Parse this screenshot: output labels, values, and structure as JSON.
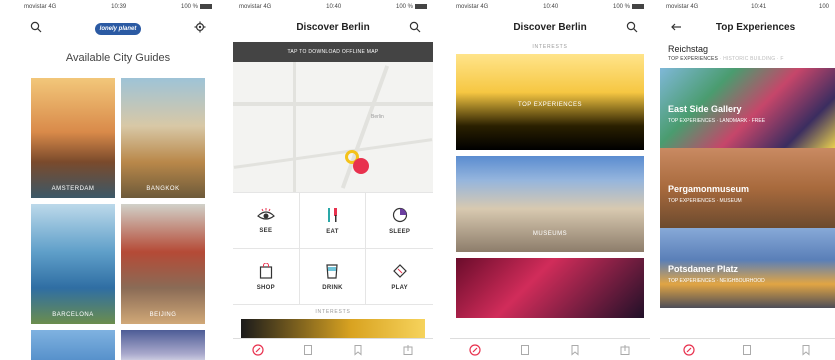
{
  "screen1": {
    "status": {
      "carrier": "movistar",
      "network": "4G",
      "time": "10:39",
      "battery": "100 %"
    },
    "logo_text": "lonely planet",
    "heading": "Available City Guides",
    "cities": [
      "AMSTERDAM",
      "BANGKOK",
      "BARCELONA",
      "BEIJING"
    ]
  },
  "screen2": {
    "status": {
      "carrier": "movistar",
      "network": "4G",
      "time": "10:40",
      "battery": "100 %"
    },
    "title": "Discover Berlin",
    "banner": "TAP TO DOWNLOAD OFFLINE MAP",
    "map_label": "Berlin",
    "categories": [
      "SEE",
      "EAT",
      "SLEEP",
      "SHOP",
      "DRINK",
      "PLAY"
    ],
    "section_label": "INTERESTS"
  },
  "screen3": {
    "status": {
      "carrier": "movistar",
      "network": "4G",
      "time": "10:40",
      "battery": "100 %"
    },
    "title": "Discover Berlin",
    "section_label": "INTERESTS",
    "features": [
      "TOP EXPERIENCES",
      "MUSEUMS",
      ""
    ]
  },
  "screen4": {
    "status": {
      "carrier": "movistar",
      "network": "4G",
      "time": "10:41",
      "battery": "100"
    },
    "title": "Top Experiences",
    "first_item": {
      "title": "Reichstag",
      "tags": "TOP EXPERIENCES",
      "tags_dim": "· HISTORIC BUILDING · F"
    },
    "items": [
      {
        "title": "East Side Gallery",
        "tags": "TOP EXPERIENCES · LANDMARK · FREE"
      },
      {
        "title": "Pergamonmuseum",
        "tags": "TOP EXPERIENCES · MUSEUM"
      },
      {
        "title": "Potsdamer Platz",
        "tags": "TOP EXPERIENCES · NEIGHBOURHOOD"
      }
    ]
  },
  "colors": {
    "accent_red": "#e8314e",
    "accent_blue": "#2b5aa3",
    "banner_dark": "#444444"
  }
}
